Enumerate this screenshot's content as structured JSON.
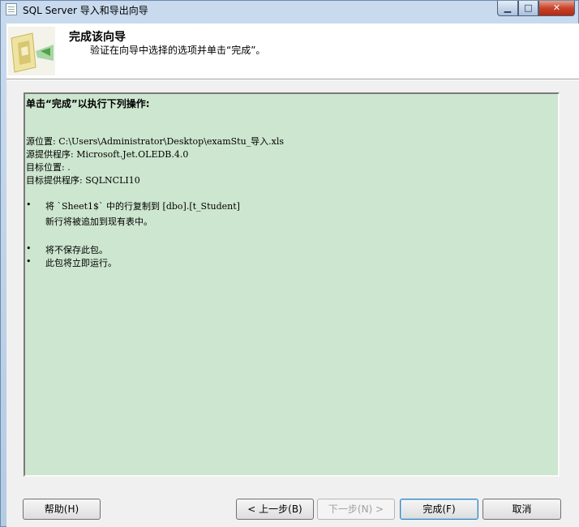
{
  "window": {
    "title": "SQL Server 导入和导出向导"
  },
  "header": {
    "title": "完成该向导",
    "subtitle": "验证在向导中选择的选项并单击“完成”。"
  },
  "summary": {
    "heading": "单击“完成”以执行下列操作:",
    "lines": [
      "源位置: C:\\Users\\Administrator\\Desktop\\examStu_导入.xls",
      "源提供程序: Microsoft.Jet.OLEDB.4.0",
      "目标位置: .",
      "目标提供程序: SQLNCLI10"
    ],
    "bullets": [
      {
        "text": "将 `Sheet1$` 中的行复制到 [dbo].[t_Student]",
        "sub": "新行将被追加到现有表中。"
      },
      {
        "text": "将不保存此包。"
      },
      {
        "text": "此包将立即运行。"
      }
    ],
    "bullet_char": "•"
  },
  "buttons": {
    "help": "帮助(H)",
    "back": "< 上一步(B)",
    "next": "下一步(N) >",
    "finish": "完成(F)",
    "cancel": "取消"
  },
  "titlebar_controls": {
    "minimize": "▁",
    "maximize": "□",
    "close": "✕"
  }
}
